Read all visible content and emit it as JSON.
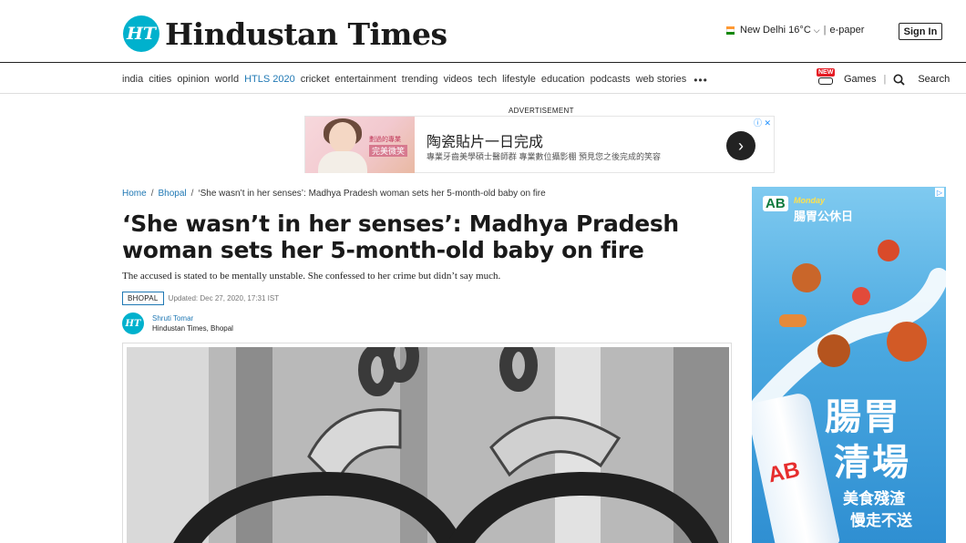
{
  "header": {
    "logo_badge": "HT",
    "logo_text": "Hindustan Times",
    "weather": "New Delhi 16°C",
    "epaper": "e-paper",
    "signin": "Sign In"
  },
  "nav": {
    "items": [
      "india",
      "cities",
      "opinion",
      "world",
      "HTLS 2020",
      "cricket",
      "entertainment",
      "trending",
      "videos",
      "tech",
      "lifestyle",
      "education",
      "podcasts",
      "web stories"
    ],
    "more": "•••",
    "new_badge": "NEW",
    "games": "Games",
    "search": "Search"
  },
  "ad_top": {
    "label": "ADVERTISEMENT",
    "tag1": "劃過的專業",
    "tag2": "完美微笑",
    "title": "陶瓷貼片一日完成",
    "subtitle": "專業牙齒美學碩士醫師群 專業數位攝影棚 預見您之後完成的笑容",
    "arrow": "›",
    "info": "ⓘ ✕"
  },
  "article": {
    "breadcrumb": [
      "Home",
      "Bhopal",
      "‘She wasn’t in her senses’: Madhya Pradesh woman sets her 5-month-old baby on fire"
    ],
    "headline": "‘She wasn’t in her senses’: Madhya Pradesh woman sets her 5-month-old baby on fire",
    "summary": "The accused is stated to be mentally unstable. She confessed to her crime but didn’t say much.",
    "tag": "BHOPAL",
    "updated": "Updated: Dec 27, 2020, 17:31 IST",
    "author_badge": "HT",
    "author_name": "Shruti Tomar",
    "author_org": "Hindustan Times, Bhopal"
  },
  "ad_side": {
    "logo": "AB",
    "monday": "Monday",
    "subtitle": "腸胃公休日",
    "big1": "腸胃",
    "big2": "清場",
    "line1": "美食殘渣",
    "line2": "慢走不送",
    "bottle_label": "AB"
  },
  "colors": {
    "brand": "#00b1cd",
    "link": "#1f78b4",
    "new_badge": "#e51b24"
  }
}
